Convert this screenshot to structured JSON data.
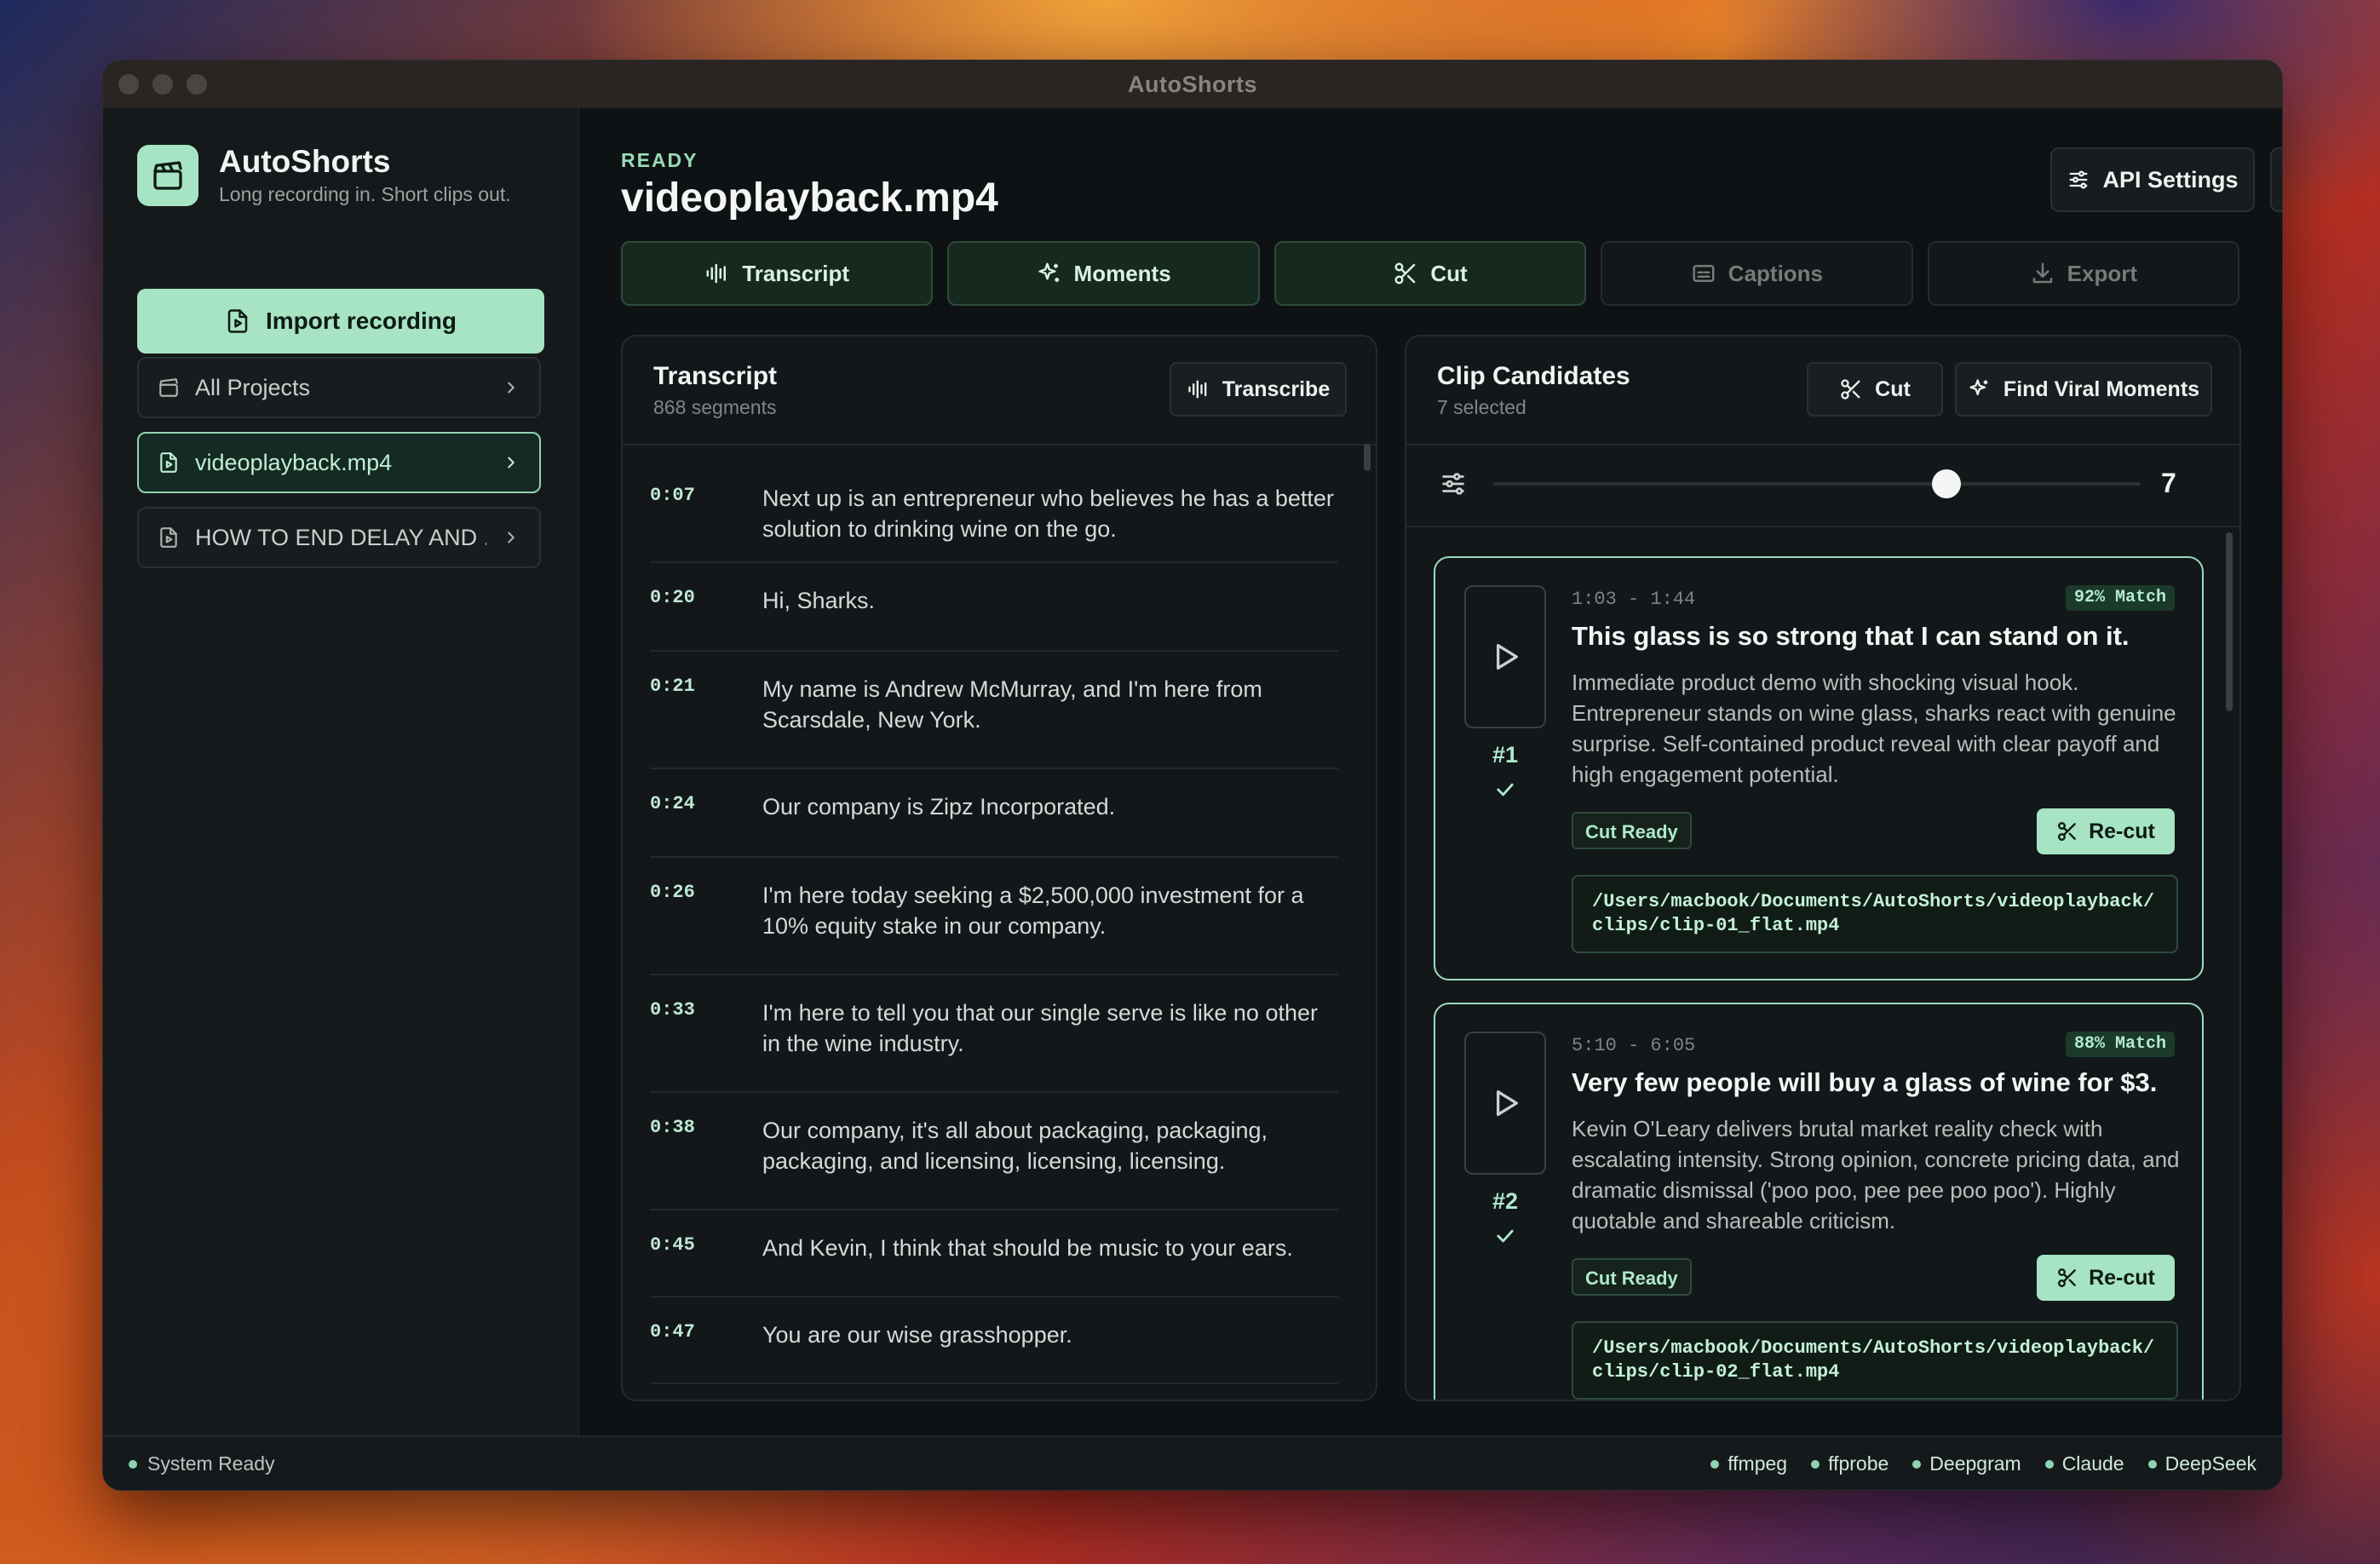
{
  "window": {
    "title": "AutoShorts"
  },
  "sidebar": {
    "brand_name": "AutoShorts",
    "brand_tagline": "Long recording in. Short clips out.",
    "import_label": "Import recording",
    "items": [
      {
        "label": "All Projects"
      },
      {
        "label": "videoplayback.mp4"
      },
      {
        "label": "HOW TO END DELAY AND ..."
      }
    ]
  },
  "header": {
    "status": "READY",
    "file_title": "videoplayback.mp4",
    "api_settings_label": "API Settings"
  },
  "tabs": [
    {
      "label": "Transcript"
    },
    {
      "label": "Moments"
    },
    {
      "label": "Cut"
    },
    {
      "label": "Captions"
    },
    {
      "label": "Export"
    }
  ],
  "transcript": {
    "title": "Transcript",
    "subtitle": "868 segments",
    "transcribe_label": "Transcribe",
    "segments": [
      {
        "time": "0:07",
        "text": "Next up is an entrepreneur who believes he has a better solution to drinking wine on the go."
      },
      {
        "time": "0:20",
        "text": "Hi, Sharks."
      },
      {
        "time": "0:21",
        "text": "My name is Andrew McMurray, and I'm here from Scarsdale, New York."
      },
      {
        "time": "0:24",
        "text": "Our company is Zipz Incorporated."
      },
      {
        "time": "0:26",
        "text": "I'm here today seeking a $2,500,000 investment for a 10% equity stake in our company."
      },
      {
        "time": "0:33",
        "text": "I'm here to tell you that our single serve is like no other in the wine industry."
      },
      {
        "time": "0:38",
        "text": "Our company, it's all about packaging, packaging, packaging, and licensing, licensing, licensing."
      },
      {
        "time": "0:45",
        "text": "And Kevin, I think that should be music to your ears."
      },
      {
        "time": "0:47",
        "text": "You are our wise grasshopper."
      }
    ]
  },
  "clips": {
    "title": "Clip Candidates",
    "subtitle": "7 selected",
    "cut_label": "Cut",
    "find_label": "Find Viral Moments",
    "slider_value": "7",
    "slider_fraction": 0.7,
    "items": [
      {
        "rank": "#1",
        "time": "1:03 - 1:44",
        "match": "92% Match",
        "title": "This glass is so strong that I can stand on it.",
        "desc": "Immediate product demo with shocking visual hook. Entrepreneur stands on wine glass, sharks react with genuine surprise. Self-contained product reveal with clear payoff and high engagement potential.",
        "status": "Cut Ready",
        "recut_label": "Re-cut",
        "path": "/Users/macbook/Documents/AutoShorts/videoplayback/clips/clip-01_flat.mp4"
      },
      {
        "rank": "#2",
        "time": "5:10 - 6:05",
        "match": "88% Match",
        "title": "Very few people will buy a glass of wine for $3.",
        "desc": "Kevin O'Leary delivers brutal market reality check with escalating intensity. Strong opinion, concrete pricing data, and dramatic dismissal ('poo poo, pee pee poo poo'). Highly quotable and shareable criticism.",
        "status": "Cut Ready",
        "recut_label": "Re-cut",
        "path": "/Users/macbook/Documents/AutoShorts/videoplayback/clips/clip-02_flat.mp4"
      }
    ]
  },
  "statusbar": {
    "system": "System Ready",
    "deps": [
      "ffmpeg",
      "ffprobe",
      "Deepgram",
      "Claude",
      "DeepSeek"
    ]
  },
  "colors": {
    "accent": "#a6e4c4",
    "background": "#0f1214"
  }
}
